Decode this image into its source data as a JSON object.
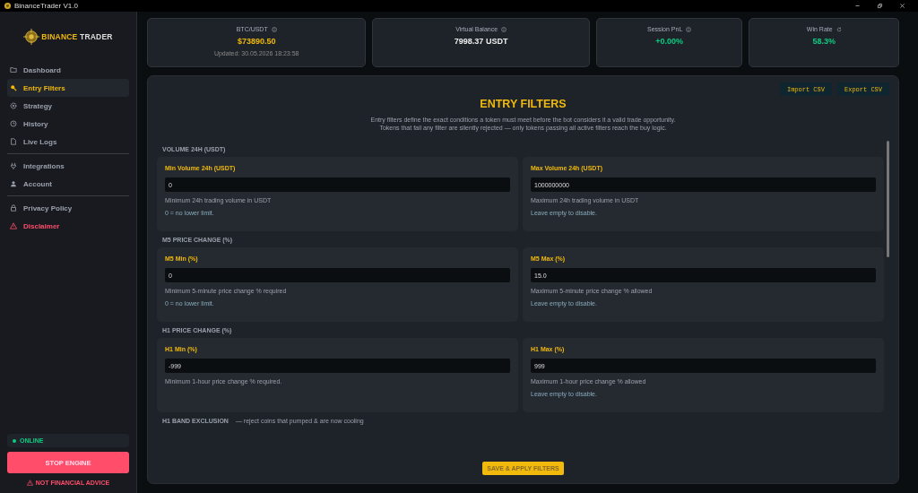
{
  "window": {
    "title": "BinanceTrader V1.0"
  },
  "sidebar": {
    "logo": {
      "first": "BINANCE",
      "second": "TRADER"
    },
    "groups": [
      [
        {
          "label": "Dashboard",
          "selected": false,
          "kind": "normal"
        },
        {
          "label": "Entry Filters",
          "selected": true,
          "kind": "normal"
        },
        {
          "label": "Strategy",
          "selected": false,
          "kind": "normal"
        },
        {
          "label": "History",
          "selected": false,
          "kind": "normal"
        },
        {
          "label": "Live Logs",
          "selected": false,
          "kind": "normal"
        }
      ],
      [
        {
          "label": "Integrations",
          "selected": false,
          "kind": "normal"
        },
        {
          "label": "Account",
          "selected": false,
          "kind": "normal"
        }
      ],
      [
        {
          "label": "Privacy Policy",
          "selected": false,
          "kind": "normal"
        },
        {
          "label": "Disclaimer",
          "selected": false,
          "kind": "danger"
        }
      ]
    ],
    "status": {
      "label": "ONLINE",
      "online": true
    },
    "stop_button": "STOP ENGINE",
    "warning": "NOT FINANCIAL ADVICE"
  },
  "stats": [
    {
      "label": "BTC/USDT",
      "value": "$73890.50",
      "kind": "accent",
      "updated": "Updated: 30.05.2026 18:23:58"
    },
    {
      "label": "Virtual Balance",
      "value": "7998.37 USDT",
      "kind": "plain"
    },
    {
      "label": "Session PnL",
      "value": "+0.00%",
      "kind": "positive"
    },
    {
      "label": "Win Rate",
      "value": "58.3%",
      "kind": "positive"
    }
  ],
  "panel": {
    "buttons": [
      "Import CSV",
      "Export CSV"
    ],
    "title": "ENTRY FILTERS",
    "description": [
      "Entry filters define the exact conditions a token must meet before the bot considers it a valid trade opportunity.",
      "Tokens that fail any filter are silently rejected — only tokens passing all active filters reach the buy logic."
    ],
    "sections": [
      {
        "label": "VOLUME 24H (USDT)",
        "fields": [
          {
            "label": "Min Volume 24h (USDT)",
            "value": "0",
            "help": "Minimum 24h trading volume in USDT",
            "note": "0 = no lower limit."
          },
          {
            "label": "Max Volume 24h (USDT)",
            "value": "1000000000",
            "help": "Maximum 24h trading volume in USDT",
            "note": "Leave empty to disable."
          }
        ]
      },
      {
        "label": "M5 PRICE CHANGE (%)",
        "fields": [
          {
            "label": "M5 Min (%)",
            "value": "0",
            "help": "Minimum 5-minute price change % required",
            "note": "0 = no lower limit."
          },
          {
            "label": "M5 Max (%)",
            "value": "15.0",
            "help": "Maximum 5-minute price change % allowed",
            "note": "Leave empty to disable."
          }
        ]
      },
      {
        "label": "H1 PRICE CHANGE (%)",
        "fields": [
          {
            "label": "H1 Min (%)",
            "value": "-999",
            "help": "Minimum 1-hour price change % required."
          },
          {
            "label": "H1 Max (%)",
            "value": "999",
            "help": "Maximum 1-hour price change % allowed",
            "note": "Leave empty to disable."
          }
        ]
      },
      {
        "label": "H1 BAND EXCLUSION",
        "hint": "— reject coins that pumped & are now cooling"
      }
    ],
    "save_button": "SAVE & APPLY FILTERS"
  }
}
